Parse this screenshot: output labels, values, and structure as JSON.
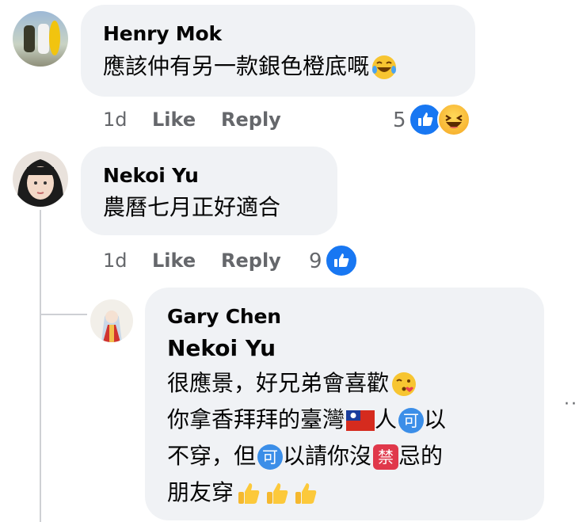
{
  "comments": [
    {
      "author": "Henry Mok",
      "text": "應該仲有另一款銀色橙底嘅",
      "time": "1d",
      "like_label": "Like",
      "reply_label": "Reply",
      "reaction_count": "5"
    },
    {
      "author": "Nekoi Yu",
      "text": "農曆七月正好適合",
      "time": "1d",
      "like_label": "Like",
      "reply_label": "Reply",
      "reaction_count": "9"
    }
  ],
  "reply": {
    "author": "Gary Chen",
    "mention": "Nekoi Yu",
    "line1": "很應景，好兄弟會喜歡",
    "line2a": "你拿香拜拜的臺灣",
    "line2b": "人",
    "line2c": "以",
    "line3a": "不穿，但",
    "line3b": "以請你沒",
    "line3c": "忌的",
    "line4": "朋友穿",
    "badge_ke": "可",
    "badge_jin": "禁"
  },
  "more_options": "··",
  "colors": {
    "bubble": "#f0f2f5",
    "like": "#1877f2",
    "meta": "#65676b"
  }
}
